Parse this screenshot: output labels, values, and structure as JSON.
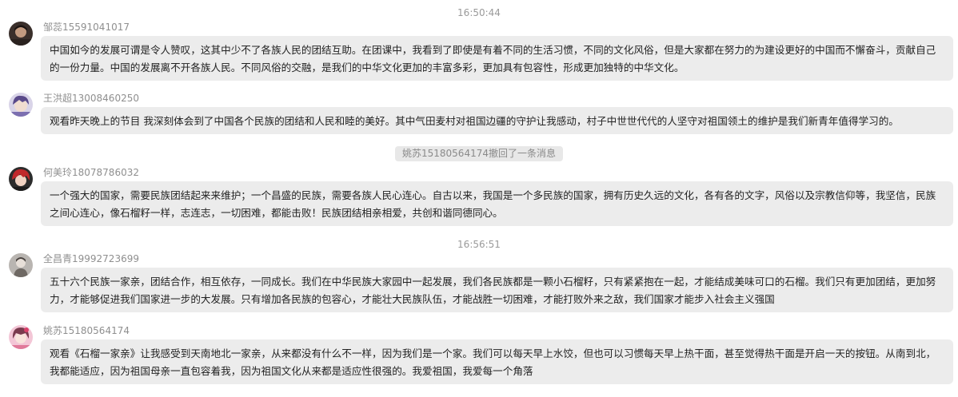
{
  "timestamps": [
    "16:50:44",
    "16:56:51"
  ],
  "messages": [
    {
      "sender": "邹蕊15591041017",
      "text": "中国如今的发展可谓是令人赞叹，这其中少不了各族人民的团结互助。在团课中，我看到了即使是有着不同的生活习惯，不同的文化风俗，但是大家都在努力的为建设更好的中国而不懈奋斗，贡献自己的一份力量。中国的发展离不开各族人民。不同风俗的交融，是我们的中华文化更加的丰富多彩，更加具有包容性，形成更加独特的中华文化。"
    },
    {
      "sender": "王洪超13008460250",
      "text": "观看昨天晚上的节目 我深刻体会到了中国各个民族的团结和人民和睦的美好。其中气田麦村对祖国边疆的守护让我感动，村子中世世代代的人坚守对祖国领土的维护是我们新青年值得学习的。"
    },
    {
      "sender": "何美玲18078786032",
      "text": "一个强大的国家，需要民族团结起来来维护；一个昌盛的民族，需要各族人民心连心。自古以来，我国是一个多民族的国家，拥有历史久远的文化，各有各的文字，风俗以及宗教信仰等，我坚信，民族之间心连心，像石榴籽一样，志连志，一切困难，都能击败！民族团结相亲相爱，共创和谐同德同心。"
    },
    {
      "sender": "全昌青19992723699",
      "text": "五十六个民族一家亲，团结合作，相互依存，一同成长。我们在中华民族大家园中一起发展，我们各民族都是一颗小石榴籽，只有紧紧抱在一起，才能结成美味可口的石榴。我们只有更加团结，更加努力，才能够促进我们国家进一步的大发展。只有增加各民族的包容心，才能壮大民族队伍，才能战胜一切困难，才能打败外来之敌，我们国家才能步入社会主义强国"
    },
    {
      "sender": "姚苏15180564174",
      "text": "观看《石榴一家亲》让我感受到天南地北一家亲，从来都没有什么不一样，因为我们是一个家。我们可以每天早上水饺，但也可以习惯每天早上热干面，甚至觉得热干面是开启一天的按钮。从南到北，我都能适应，因为祖国母亲一直包容着我，因为祖国文化从来都是适应性很强的。我爱祖国，我爱每一个角落"
    }
  ],
  "recall_notice": "姚苏15180564174撤回了一条消息",
  "colors": {
    "bubble": "#ececec",
    "recall_bg": "#e8e8e8",
    "meta_text": "#8f8f8f",
    "body_text": "#222222"
  },
  "avatars": [
    "dark-portrait-avatar",
    "anime-character-avatar",
    "red-hair-anime-avatar",
    "gray-figure-avatar",
    "pink-anime-avatar"
  ]
}
